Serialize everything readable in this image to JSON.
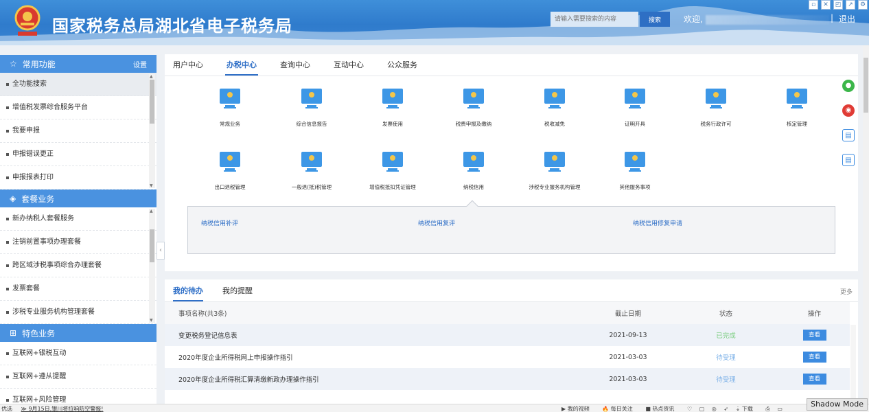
{
  "header": {
    "site_title": "国家税务总局湖北省电子税务局",
    "search_placeholder": "请输入需要搜索的内容",
    "search_button": "搜索",
    "welcome": "欢迎,",
    "logout": "退出",
    "logout_sep": "|"
  },
  "sidebar": {
    "sections": [
      {
        "title": "常用功能",
        "icon": "star-icon",
        "action": "设置",
        "items": [
          "全功能搜索",
          "增值税发票综合服务平台",
          "我要申报",
          "申报错误更正",
          "申报报表打印"
        ]
      },
      {
        "title": "套餐业务",
        "icon": "box-icon",
        "items": [
          "新办纳税人套餐服务",
          "注销前置事项办理套餐",
          "跨区域涉税事项综合办理套餐",
          "发票套餐",
          "涉税专业服务机构管理套餐"
        ]
      },
      {
        "title": "特色业务",
        "icon": "grid-icon",
        "items": [
          "互联网+银税互动",
          "互联网+遵从提醒",
          "互联网+风险管理"
        ]
      }
    ]
  },
  "main": {
    "tabs": [
      "用户中心",
      "办税中心",
      "查询中心",
      "互动中心",
      "公众服务"
    ],
    "active_tab": "办税中心",
    "functions_row1": [
      "常规业务",
      "综合信息报告",
      "发票使用",
      "税费申报及缴纳",
      "税收减免",
      "证明开具",
      "税务行政许可",
      "核定管理"
    ],
    "functions_row2": [
      "出口退税管理",
      "一般退(抵)税管理",
      "增值税抵扣凭证管理",
      "纳税信用",
      "涉税专业服务机构管理",
      "其他服务事项"
    ],
    "sub_links": [
      "纳税信用补评",
      "纳税信用复评",
      "纳税信用修复申请"
    ]
  },
  "todo": {
    "tabs": [
      "我的待办",
      "我的提醒"
    ],
    "more": "更多",
    "headers": [
      "事项名称(共3条)",
      "截止日期",
      "状态",
      "操作"
    ],
    "rows": [
      {
        "name": "变更税务登记信息表",
        "date": "2021-09-13",
        "status": "已完成",
        "action": "查看"
      },
      {
        "name": "2020年度企业所得税网上申报操作指引",
        "date": "2021-03-03",
        "status": "待受理",
        "action": "查看"
      },
      {
        "name": "2020年度企业所得税汇算清缴新政办理操作指引",
        "date": "2021-03-03",
        "status": "待受理",
        "action": "查看"
      }
    ]
  },
  "statusbar": {
    "left_label": "优选",
    "left_link": "9月15日,银川将拉响防空警报!",
    "right_items": [
      "我的视频",
      "每日关注",
      "热点资讯",
      "下载"
    ],
    "shadow_mode": "Shadow Mode"
  },
  "colors": {
    "brand_blue": "#2f6fc7",
    "header_blue": "#3a85d2",
    "sidebar_section": "#4a92e0",
    "status_done": "#7ecf83",
    "status_wait": "#7fb3e8"
  }
}
